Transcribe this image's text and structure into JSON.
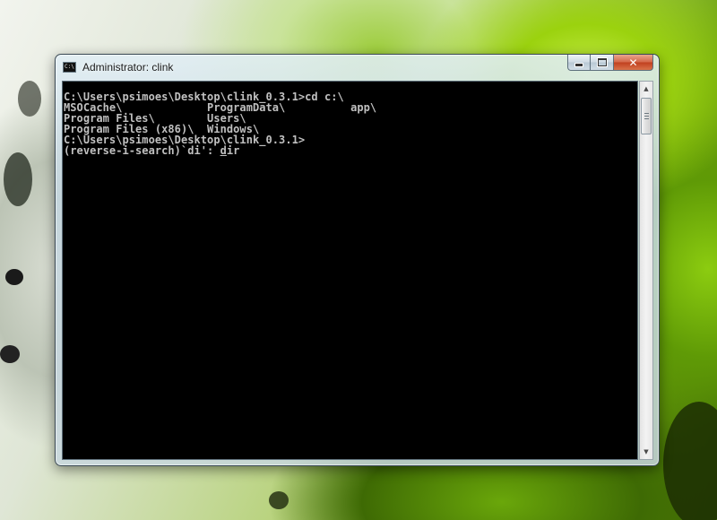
{
  "window": {
    "title": "Administrator:  clink",
    "app_icon": "console-icon",
    "app_icon_text": "C:\\"
  },
  "controls": {
    "minimize_icon": "minimize-icon",
    "maximize_icon": "maximize-icon",
    "close_icon": "close-icon",
    "close_glyph": "✕"
  },
  "console": {
    "lines": [
      "C:\\Users\\psimoes\\Desktop\\clink_0.3.1>cd c:\\",
      "MSOCache\\             ProgramData\\          app\\",
      "Program Files\\        Users\\",
      "Program Files (x86)\\  Windows\\",
      "C:\\Users\\psimoes\\Desktop\\clink_0.3.1>"
    ],
    "search_prompt": "(reverse-i-search)`di': ",
    "search_match_cursor": "d",
    "search_match_rest": "ir"
  },
  "scrollbar": {
    "up_icon": "scroll-up-arrow-icon",
    "down_icon": "scroll-down-arrow-icon",
    "up_glyph": "▲",
    "down_glyph": "▼"
  },
  "colors": {
    "console_background": "#000000",
    "console_text": "#c0c0c0",
    "close_button": "#c1401f"
  }
}
